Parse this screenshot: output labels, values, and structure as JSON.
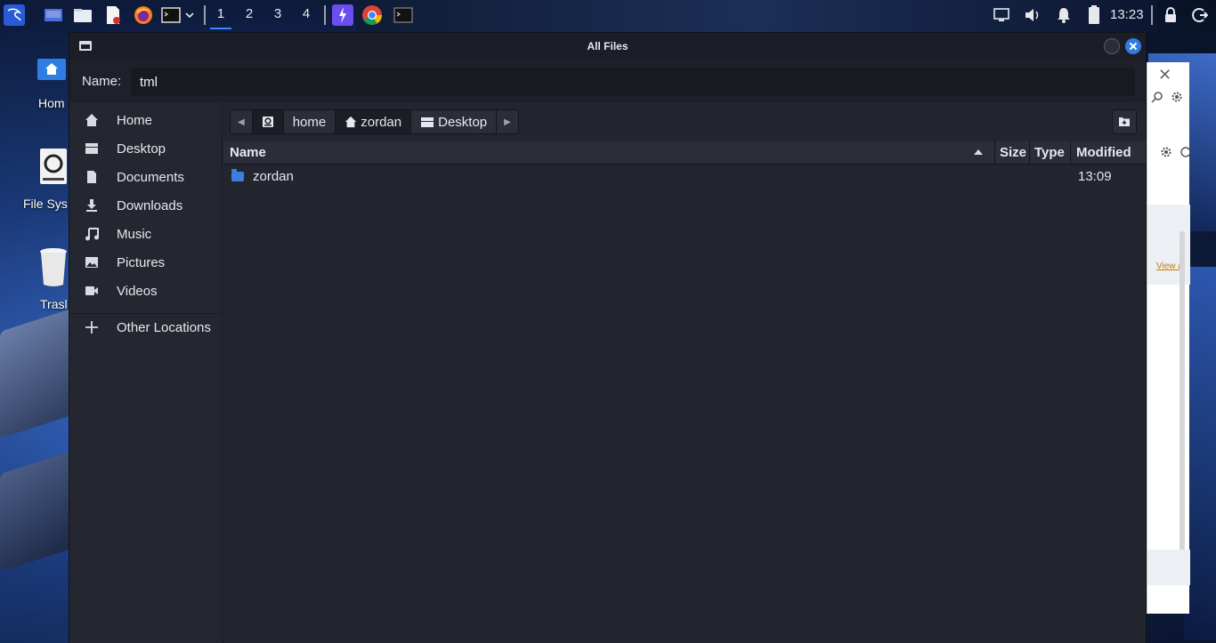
{
  "panel": {
    "workspaces": [
      "1",
      "2",
      "3",
      "4"
    ],
    "active_workspace": "1",
    "clock": "13:23",
    "launcher_icons": [
      "kali-menu-icon",
      "desktop-icon",
      "file-manager-icon",
      "text-editor-icon",
      "firefox-icon",
      "terminal-icon",
      "dropdown-chevron-icon"
    ],
    "pinned_icons": [
      "burp-icon",
      "chrome-icon",
      "terminal-icon"
    ],
    "tray_icons": [
      "display-icon",
      "volume-icon",
      "notification-bell-icon",
      "battery-icon",
      "lock-icon",
      "logout-icon"
    ]
  },
  "desktop": {
    "icons": [
      {
        "label": "Hom",
        "icon": "home-folder-icon"
      },
      {
        "label": "File Sys",
        "icon": "drive-icon"
      },
      {
        "label": "Trasl",
        "icon": "trash-icon"
      }
    ]
  },
  "background_window": {
    "link_text": "View a"
  },
  "dialog": {
    "title": "All Files",
    "name_label": "Name:",
    "name_value": "tml",
    "sidebar": [
      {
        "label": "Home",
        "icon": "home-icon"
      },
      {
        "label": "Desktop",
        "icon": "desktop-icon"
      },
      {
        "label": "Documents",
        "icon": "document-icon"
      },
      {
        "label": "Downloads",
        "icon": "download-icon"
      },
      {
        "label": "Music",
        "icon": "music-icon"
      },
      {
        "label": "Pictures",
        "icon": "picture-icon"
      },
      {
        "label": "Videos",
        "icon": "video-icon"
      }
    ],
    "other_locations": "Other Locations",
    "path": [
      "home",
      "zordan",
      "Desktop"
    ],
    "columns": {
      "name": "Name",
      "size": "Size",
      "type": "Type",
      "modified": "Modified"
    },
    "sort_column": "Name",
    "sort_direction": "ascending",
    "files": [
      {
        "name": "zordan",
        "size": "",
        "type": "",
        "modified": "13:09"
      }
    ]
  },
  "colors": {
    "accent": "#2f7de1",
    "folder": "#3d7fe0",
    "dialog_bg": "#23252f"
  }
}
